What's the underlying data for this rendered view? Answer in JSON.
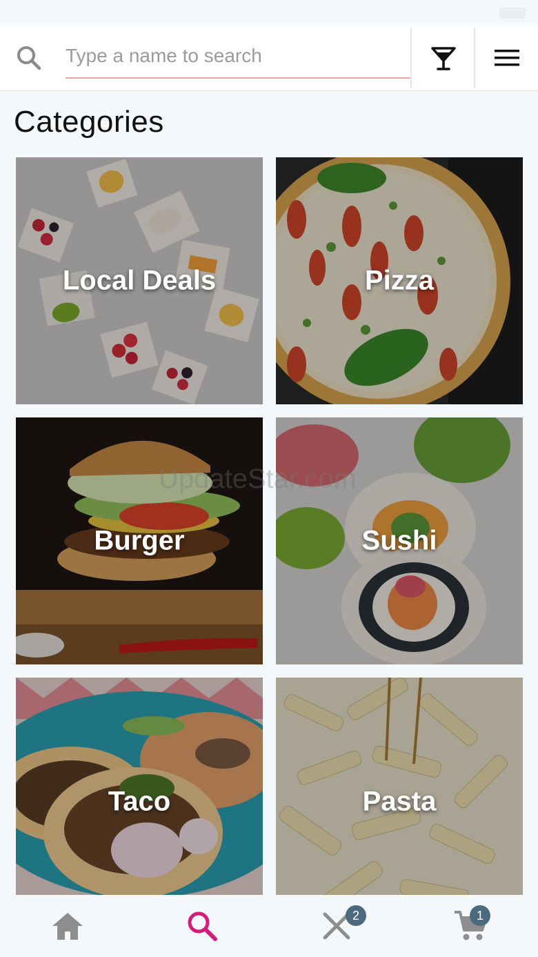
{
  "search": {
    "placeholder": "Type a name to search"
  },
  "section": {
    "title": "Categories"
  },
  "categories": [
    {
      "label": "Local Deals",
      "image": "appetizers-photo"
    },
    {
      "label": "Pizza",
      "image": "pizza-photo"
    },
    {
      "label": "Burger",
      "image": "burger-photo"
    },
    {
      "label": "Sushi",
      "image": "sushi-photo"
    },
    {
      "label": "Taco",
      "image": "taco-photo"
    },
    {
      "label": "Pasta",
      "image": "pasta-photo"
    }
  ],
  "tabs": [
    {
      "name": "home",
      "icon": "home-icon",
      "active": false
    },
    {
      "name": "search",
      "icon": "search-icon",
      "active": true
    },
    {
      "name": "orders",
      "icon": "fork-knife-icon",
      "badge": "2",
      "active": false
    },
    {
      "name": "cart",
      "icon": "cart-icon",
      "badge": "1",
      "active": false
    }
  ],
  "watermark": "UpdateStar.com",
  "colors": {
    "accent": "#d81b7a",
    "inactive_icon": "#8e8e8e",
    "badge": "#4a6a80",
    "input_underline": "#f0a0a8"
  }
}
